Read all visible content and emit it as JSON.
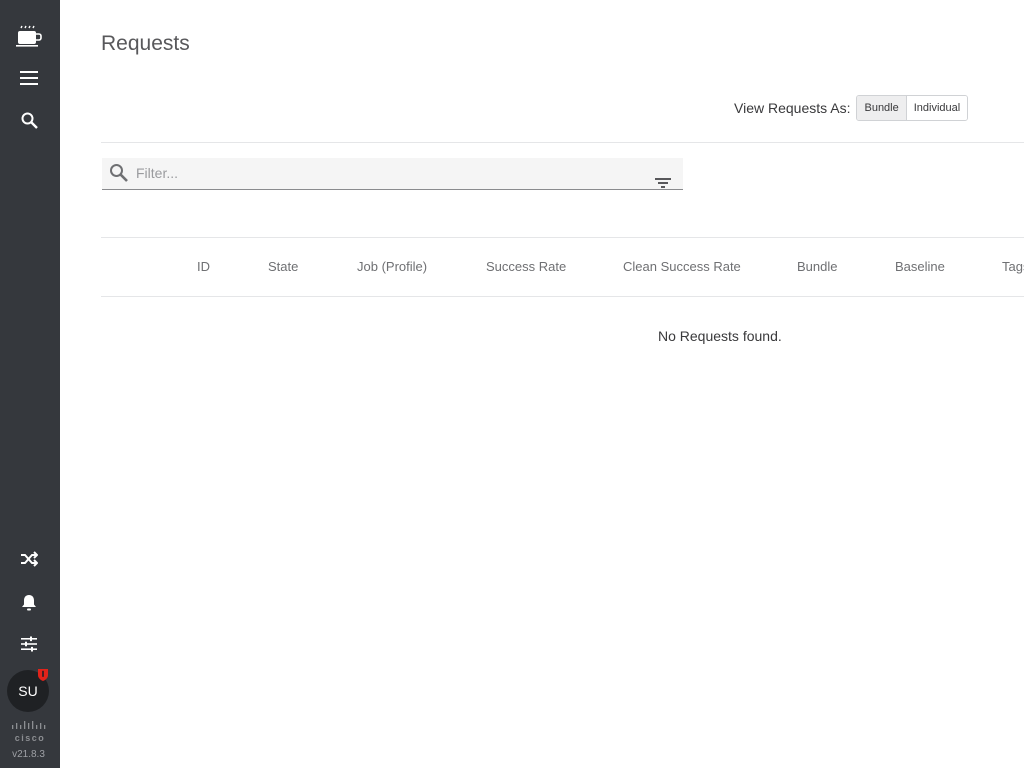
{
  "sidebar": {
    "icons": [
      "coffee-cup-icon",
      "menu-icon",
      "search-icon",
      "shuffle-icon",
      "bell-icon",
      "sliders-icon"
    ],
    "user_initials": "SU",
    "version": "v21.8.3",
    "logo": "cisco"
  },
  "page": {
    "title": "Requests"
  },
  "view_toggle": {
    "label": "View Requests As:",
    "options": [
      "Bundle",
      "Individual"
    ],
    "selected": "Bundle"
  },
  "filter": {
    "placeholder": "Filter..."
  },
  "table": {
    "columns": [
      "ID",
      "State",
      "Job (Profile)",
      "Success Rate",
      "Clean Success Rate",
      "Bundle",
      "Baseline",
      "Tags"
    ],
    "empty_message": "No Requests found."
  },
  "colors": {
    "sidebar_bg": "#35383d",
    "badge": "#e2231a"
  }
}
